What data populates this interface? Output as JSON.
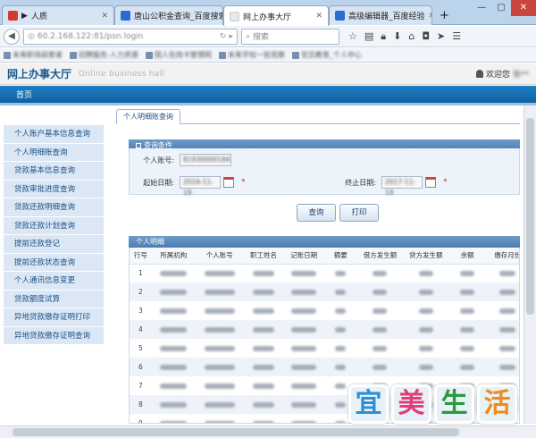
{
  "browser": {
    "tabs": [
      {
        "label": "人质",
        "color": "#d33b2c",
        "audio": "▶",
        "active": false
      },
      {
        "label": "唐山公积金查询_百度搜索",
        "color": "#2b6cd1",
        "active": false
      },
      {
        "label": "网上办事大厅",
        "color": "#e8e8e8",
        "active": true
      },
      {
        "label": "高级编辑器_百度经验",
        "color": "#2b6cd1",
        "active": false
      }
    ],
    "new_tab": "+",
    "url": "60.2.168.122:81/psn.login",
    "search_placeholder": "搜索",
    "bookmarks": [
      "未来职场探索者",
      "招聘服务-人力资源",
      "国人在岗卡管理网",
      "未来学校一些观察",
      "党员教育_个人中心"
    ]
  },
  "site": {
    "title": "网上办事大厅",
    "subtitle": "Online business hall",
    "welcome": "欢迎您",
    "username": "张**",
    "menu_home": "首页"
  },
  "sidebar": {
    "items": [
      "个人账户基本信息查询",
      "个人明细账查询",
      "贷款基本信息查询",
      "贷款审批进度查询",
      "贷款还款明细查询",
      "贷款还款计划查询",
      "提前还款登记",
      "提前还款状态查询",
      "个人通讯信息变更",
      "贷款额度试算",
      "异地贷款缴存证明打印",
      "异地贷款缴存证明查询"
    ]
  },
  "content": {
    "tab": "个人明细账查询",
    "query_header": "查询条件",
    "account_label": "个人账号:",
    "account_value": "81930000184",
    "start_label": "起始日期:",
    "start_value": "2016-11-19",
    "end_label": "终止日期:",
    "end_value": "2017-11-19",
    "required_mark": "*",
    "query_button": "查询",
    "print_button": "打印",
    "detail_header": "个人明细",
    "columns": [
      "行号",
      "所属机构",
      "个人账号",
      "职工姓名",
      "记账日期",
      "摘要",
      "借方发生额",
      "贷方发生额",
      "余额",
      "缴存月份"
    ],
    "row_numbers": [
      "1",
      "2",
      "3",
      "4",
      "5",
      "6",
      "7",
      "8",
      "9"
    ]
  },
  "watermark": {
    "chars": [
      "宜",
      "美",
      "生",
      "活"
    ],
    "colors": [
      "#2a8fd8",
      "#e23b7a",
      "#2b9a3d",
      "#f08a1c"
    ]
  }
}
